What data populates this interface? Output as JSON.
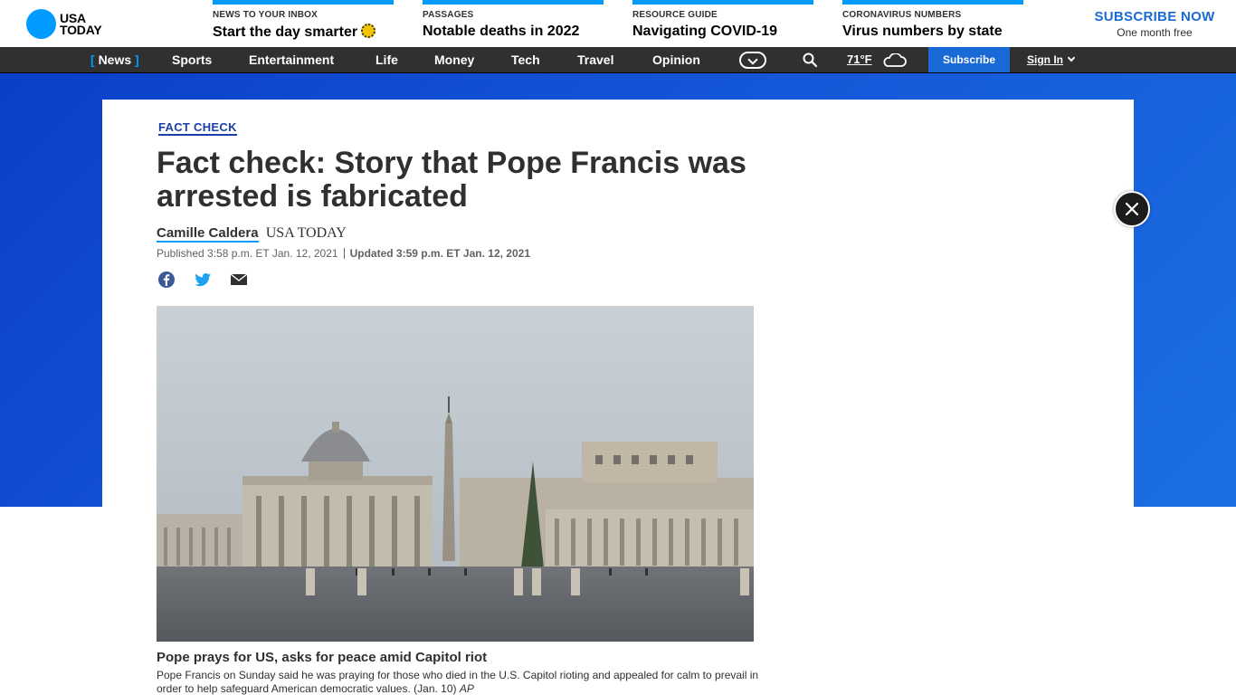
{
  "brand": {
    "line1": "USA",
    "line2": "TODAY"
  },
  "promos": [
    {
      "kicker": "NEWS TO YOUR INBOX",
      "headline": "Start the day smarter"
    },
    {
      "kicker": "PASSAGES",
      "headline": "Notable deaths in 2022"
    },
    {
      "kicker": "RESOURCE GUIDE",
      "headline": "Navigating COVID-19"
    },
    {
      "kicker": "CORONAVIRUS NUMBERS",
      "headline": "Virus numbers by state"
    }
  ],
  "subscribe_cta": {
    "title": "SUBSCRIBE NOW",
    "subtitle": "One month free"
  },
  "nav": {
    "items": [
      "News",
      "Sports",
      "Entertainment",
      "Life",
      "Money",
      "Tech",
      "Travel",
      "Opinion"
    ],
    "bracket_open": "[",
    "bracket_close": "]",
    "temperature": "71°F",
    "subscribe": "Subscribe",
    "sign_in": "Sign In"
  },
  "article": {
    "tag": "FACT CHECK",
    "title": "Fact check: Story that Pope Francis was arrested is fabricated",
    "author": "Camille Caldera",
    "outlet": "USA TODAY",
    "published": "Published 3:58 p.m. ET Jan. 12, 2021",
    "updated": "Updated 3:59 p.m. ET Jan. 12, 2021",
    "caption_title": "Pope prays for US, asks for peace amid Capitol riot",
    "caption_text": "Pope Francis on Sunday said he was praying for those who died in the U.S. Capitol rioting and appealed for calm to prevail in order to help safeguard American democratic values. (Jan. 10)",
    "caption_credit": "AP"
  },
  "icons": {
    "share": [
      "facebook-icon",
      "twitter-icon",
      "email-icon"
    ],
    "weather": "cloud-icon",
    "close": "close-icon"
  },
  "colors": {
    "brand_blue": "#009bff",
    "nav_bg": "#303030",
    "subscribe_blue": "#1a6ad6",
    "hero_blue": "#1456d8"
  }
}
